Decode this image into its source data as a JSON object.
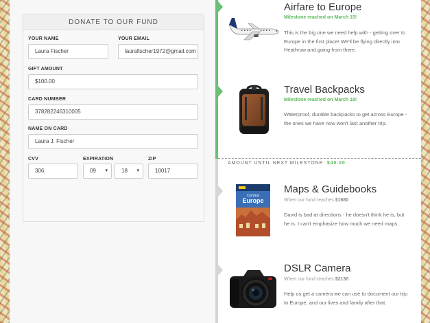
{
  "form": {
    "header": "DONATE TO OUR FUND",
    "name_label": "YOUR NAME",
    "name_value": "Laura Fischer",
    "email_label": "YOUR EMAIL",
    "email_value": "laurafischer1972@gmail.com",
    "amount_label": "GIFT AMOUNT",
    "amount_value": "$100.00",
    "card_label": "CARD NUMBER",
    "card_value": "378282246310005",
    "card_name_label": "NAME ON CARD",
    "card_name_value": "Laura J. Fischer",
    "cvv_label": "CVV",
    "cvv_value": "306",
    "exp_label": "EXPIRATION",
    "exp_month": "09",
    "exp_year": "18",
    "zip_label": "ZIP",
    "zip_value": "10017"
  },
  "timeline": {
    "next_label": "AMOUNT UNTIL NEXT MILESTONE:",
    "next_value": "$40.00",
    "colors": {
      "reached": "#6cbf74",
      "pending": "#d6d6d6"
    },
    "items": [
      {
        "title": "Airfare to Europe",
        "status": "Milestone reached on March 15!",
        "desc": "This is the big one we need help with - getting over to Europe in the first place! We'll be flying directly into Heathrow and going from there.",
        "icon": "airplane-icon"
      },
      {
        "title": "Travel Backpacks",
        "status": "Milestone reached on March 18!",
        "desc": "Waterproof, durable backpacks to get across Europe - the ones we have now won't last another trip.",
        "icon": "backpack-icon"
      },
      {
        "title": "Maps & Guidebooks",
        "status_prefix": "When our fund reaches",
        "status_amount": "$1680",
        "desc": "David is bad at directions - he doesn't think he is, but he is. I can't emphasize how much we need maps.",
        "icon": "guidebook-icon"
      },
      {
        "title": "DSLR Camera",
        "status_prefix": "When our fund reaches",
        "status_amount": "$2130",
        "desc": "Help us get a camera we can use to document our trip to Europe, and our lives and family after that.",
        "icon": "camera-icon"
      }
    ],
    "guidebook_cover": {
      "line1": "Central",
      "line2": "Europe"
    }
  }
}
